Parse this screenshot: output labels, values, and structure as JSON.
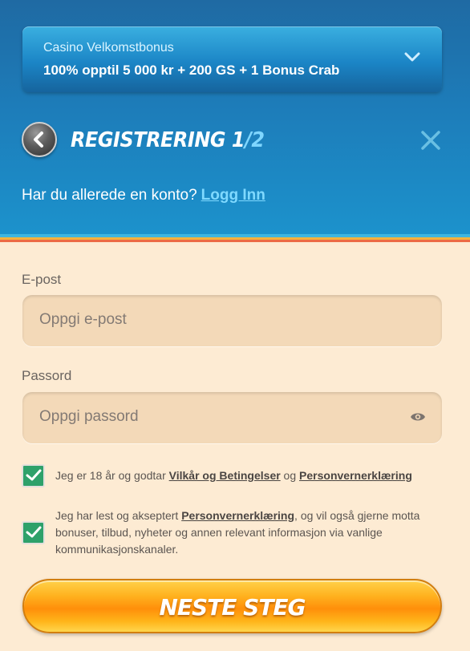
{
  "bonus": {
    "title": "Casino Velkomstbonus",
    "offer": "100% opptil 5 000 kr + 200 GS + 1 Bonus Crab"
  },
  "header": {
    "title": "REGISTRERING 1",
    "step_suffix": "/2"
  },
  "login": {
    "prompt": "Har du allerede en konto?",
    "link": "Logg Inn"
  },
  "form": {
    "email_label": "E-post",
    "email_placeholder": "Oppgi e-post",
    "password_label": "Passord",
    "password_placeholder": "Oppgi passord"
  },
  "consents": [
    {
      "checked": true,
      "pre": "Jeg er 18 år og godtar ",
      "link1": "Vilkår og Betingelser",
      "mid": " og ",
      "link2": "Personvernerklæring",
      "post": ""
    },
    {
      "checked": true,
      "pre": "Jeg har lest og akseptert ",
      "link1": "Personvernerklæring",
      "post": ", og vil også gjerne motta bonuser, tilbud, nyheter og annen relevant informasjon via vanlige kommunikasjonskanaler."
    }
  ],
  "cta": {
    "label": "NESTE STEG"
  },
  "colors": {
    "accent_blue": "#1d7cb9",
    "link_cyan": "#7fd9ff",
    "checkbox_green": "#2ea16a",
    "cta_orange": "#ff9f12",
    "background_cream": "#fdebd3"
  },
  "icons": [
    "chevron-down-icon",
    "back-arrow-icon",
    "close-icon",
    "eye-icon",
    "checkmark-icon"
  ]
}
